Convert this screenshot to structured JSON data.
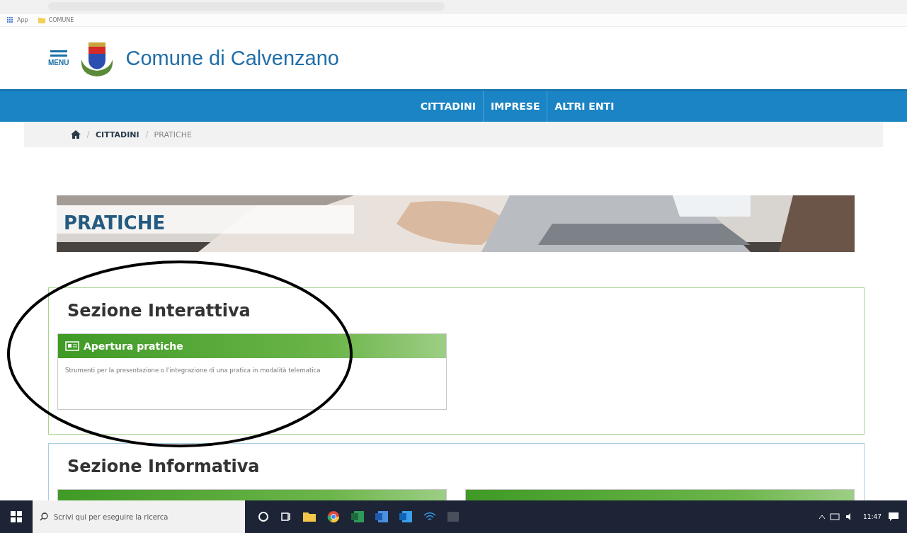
{
  "browser": {
    "bookmarks": [
      {
        "label": "App",
        "kind": "apps"
      },
      {
        "label": "COMUNE",
        "kind": "folder"
      }
    ]
  },
  "header": {
    "menu_label": "MENU",
    "title": "Comune di Calvenzano"
  },
  "nav": [
    {
      "label": "CITTADINI"
    },
    {
      "label": "IMPRESE"
    },
    {
      "label": "ALTRI ENTI"
    }
  ],
  "breadcrumb": [
    "CITTADINI",
    "PRATICHE"
  ],
  "banner": {
    "title": "PRATICHE"
  },
  "sections": [
    {
      "title": "Sezione Interattiva",
      "kind": "interactive",
      "cards": [
        {
          "kind": "full",
          "title": "Apertura pratiche",
          "description": "Strumenti per la presentazione o l'integrazione di una pratica in modalità telematica"
        }
      ]
    },
    {
      "title": "Sezione Informativa",
      "kind": "informative",
      "cards": [
        {
          "kind": "cut-off"
        },
        {
          "kind": "cut-off"
        }
      ]
    }
  ],
  "taskbar": {
    "search_placeholder": "Scrivi qui per eseguire la ricerca",
    "clock": "11:47"
  }
}
